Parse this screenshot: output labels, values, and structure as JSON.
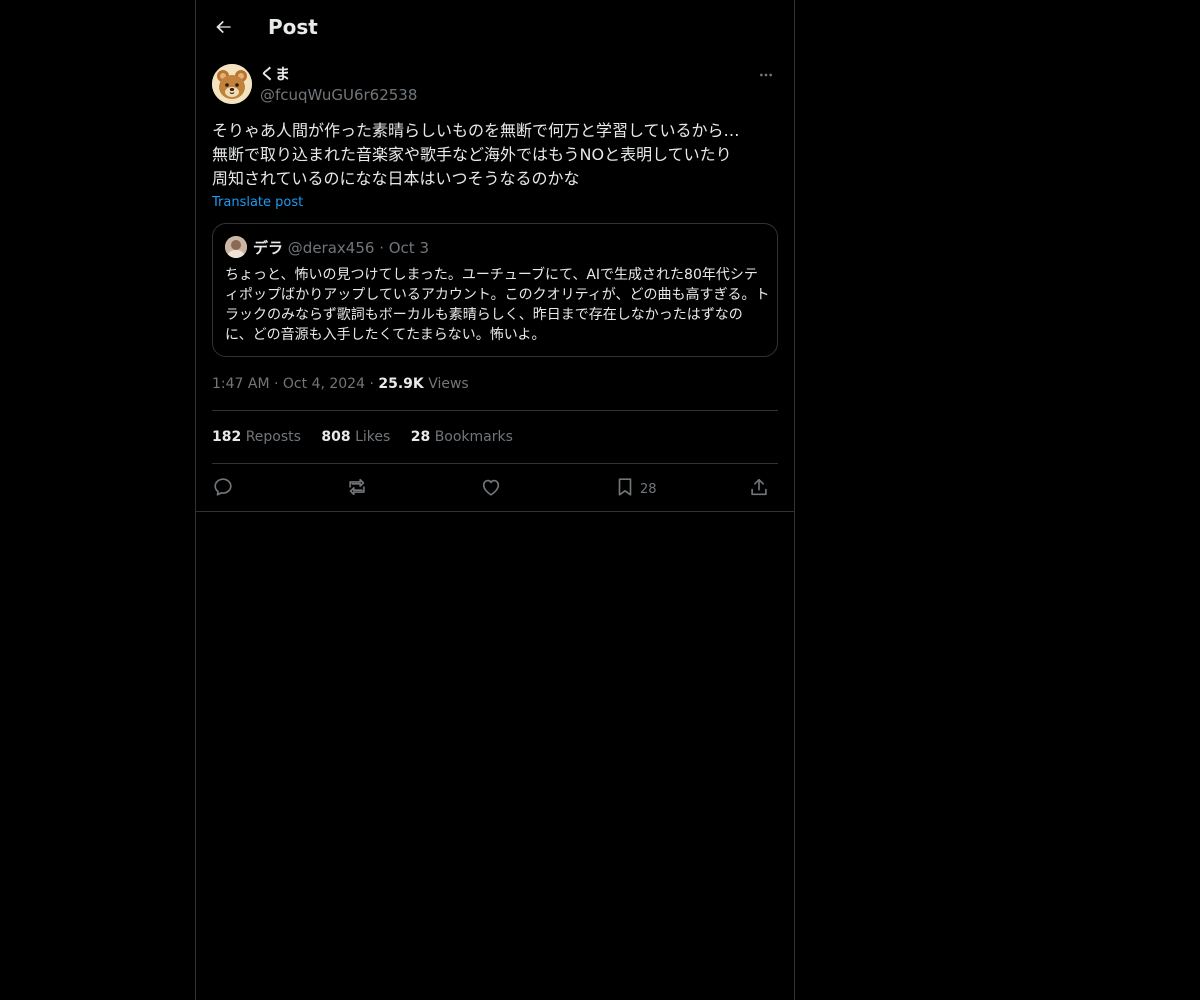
{
  "header": {
    "title": "Post"
  },
  "post": {
    "author_name": "くま",
    "author_handle": "@fcuqWuGU6r62538",
    "text": "そりゃあ人間が作った素晴らしいものを無断で何万と学習しているから…\n無断で取り込まれた音楽家や歌手など海外ではもうNOと表明していたり\n周知されているのになな日本はいつそうなるのかな",
    "translate_label": "Translate post",
    "time": "1:47 AM",
    "date": "Oct 4, 2024",
    "views_count": "25.9K",
    "views_label": "Views"
  },
  "quote": {
    "author_name": "デラ",
    "author_handle": "@derax456",
    "date": "Oct 3",
    "text": "ちょっと、怖いの見つけてしまった。ユーチューブにて、AIで生成された80年代シティポップばかりアップしているアカウント。このクオリティが、どの曲も高すぎる。トラックのみならず歌詞もボーカルも素晴らしく、昨日まで存在しなかったはずなのに、どの音源も入手したくてたまらない。怖いよ。"
  },
  "stats": {
    "reposts_count": "182",
    "reposts_label": "Reposts",
    "likes_count": "808",
    "likes_label": "Likes",
    "bookmarks_count": "28",
    "bookmarks_label": "Bookmarks"
  },
  "actions": {
    "bookmark_count": "28"
  },
  "colors": {
    "background": "#000000",
    "text_primary": "#e7e9ea",
    "text_secondary": "#71767b",
    "link": "#1d9bf0",
    "border": "#2f3336"
  },
  "icons": {
    "back": "arrow-left-icon",
    "more": "more-horizontal-icon",
    "reply": "reply-icon",
    "repost": "repost-icon",
    "like": "heart-icon",
    "bookmark": "bookmark-icon",
    "share": "share-icon"
  }
}
